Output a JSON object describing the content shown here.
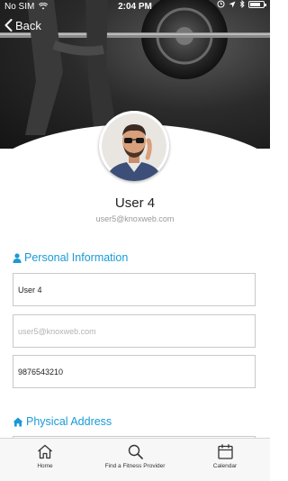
{
  "status_bar": {
    "carrier": "No SIM",
    "time": "2:04 PM",
    "battery_level": 0.8,
    "icons": [
      "wifi-icon",
      "alarm-icon",
      "location-icon",
      "bluetooth-icon",
      "battery-icon"
    ]
  },
  "nav": {
    "back_label": "Back",
    "back_icon": "chevron-left-icon"
  },
  "profile": {
    "name": "User 4",
    "email": "user5@knoxweb.com"
  },
  "personal_info": {
    "title": "Personal Information",
    "icon": "user-icon",
    "name_value": "User 4",
    "email_placeholder": "user5@knoxweb.com",
    "phone_value": "9876543210"
  },
  "physical_address": {
    "title": "Physical Address",
    "icon": "home-icon"
  },
  "tabbar": {
    "items": [
      {
        "label": "Home",
        "icon": "house-icon"
      },
      {
        "label": "Find a Fitness Provider",
        "icon": "search-icon"
      },
      {
        "label": "Calendar",
        "icon": "calendar-icon"
      }
    ]
  },
  "colors": {
    "accent": "#1a9ad6",
    "hero_dark": "#141414",
    "tabbar_bg": "#f7f7f7"
  }
}
